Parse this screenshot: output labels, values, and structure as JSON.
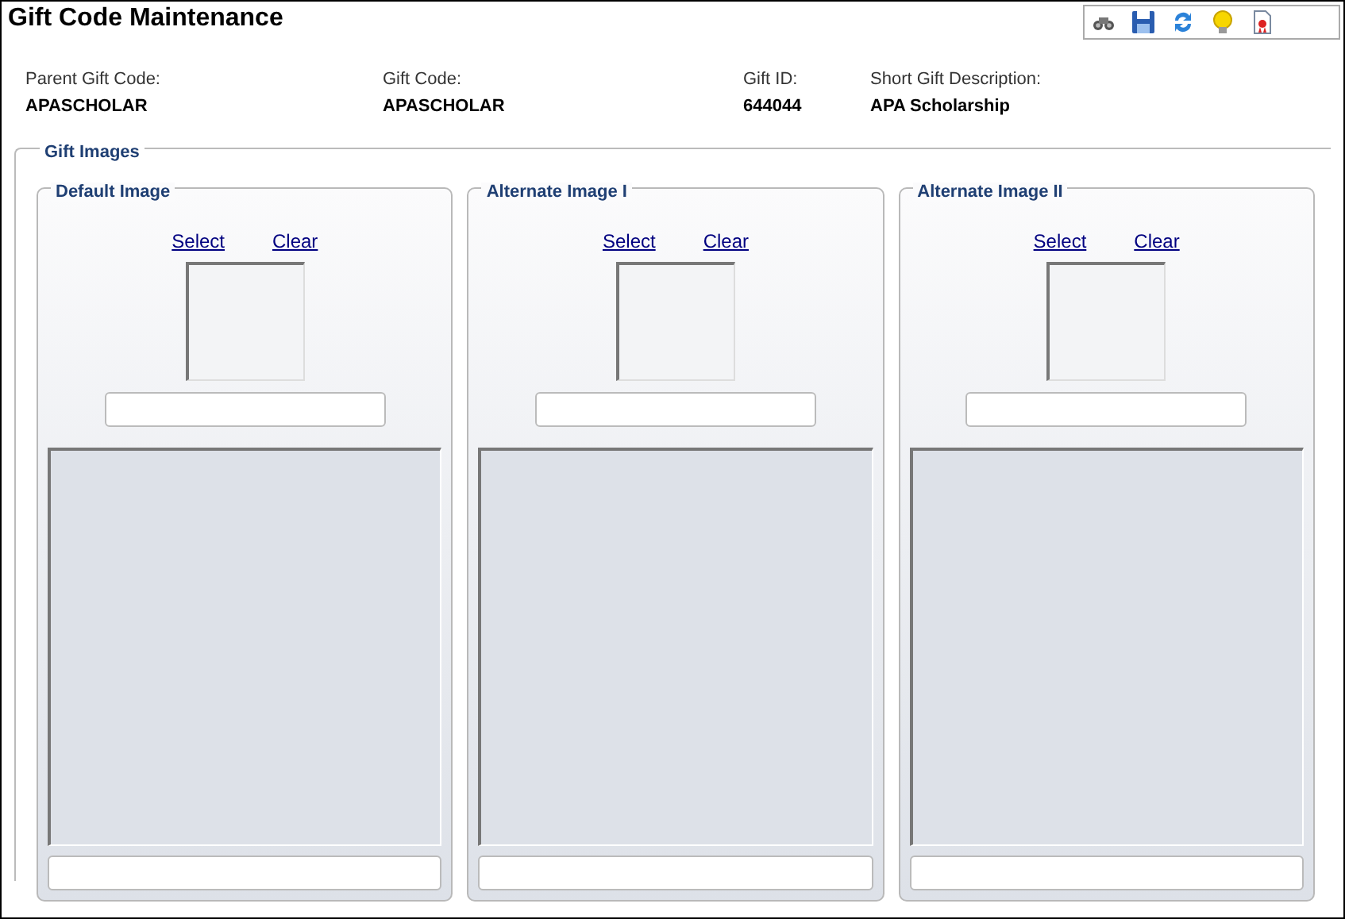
{
  "window": {
    "title": "Gift Code Maintenance"
  },
  "toolbar": [
    {
      "kind": "binoculars"
    },
    {
      "kind": "save"
    },
    {
      "kind": "refresh"
    },
    {
      "kind": "bulb"
    },
    {
      "kind": "report"
    }
  ],
  "fields": [
    {
      "label": "Parent Gift Code:",
      "value": "APASCHOLAR"
    },
    {
      "label": "Gift Code:",
      "value": "APASCHOLAR"
    },
    {
      "label": "Gift ID:",
      "value": "644044"
    },
    {
      "label": "Short Gift Description:",
      "value": "APA Scholarship"
    }
  ],
  "gift_images": {
    "title": "Gift Images",
    "panels": [
      {
        "title": "Default Image",
        "select": "Select",
        "clear": "Clear"
      },
      {
        "title": "Alternate Image I",
        "select": "Select",
        "clear": "Clear"
      },
      {
        "title": "Alternate Image II",
        "select": "Select",
        "clear": "Clear"
      }
    ]
  }
}
